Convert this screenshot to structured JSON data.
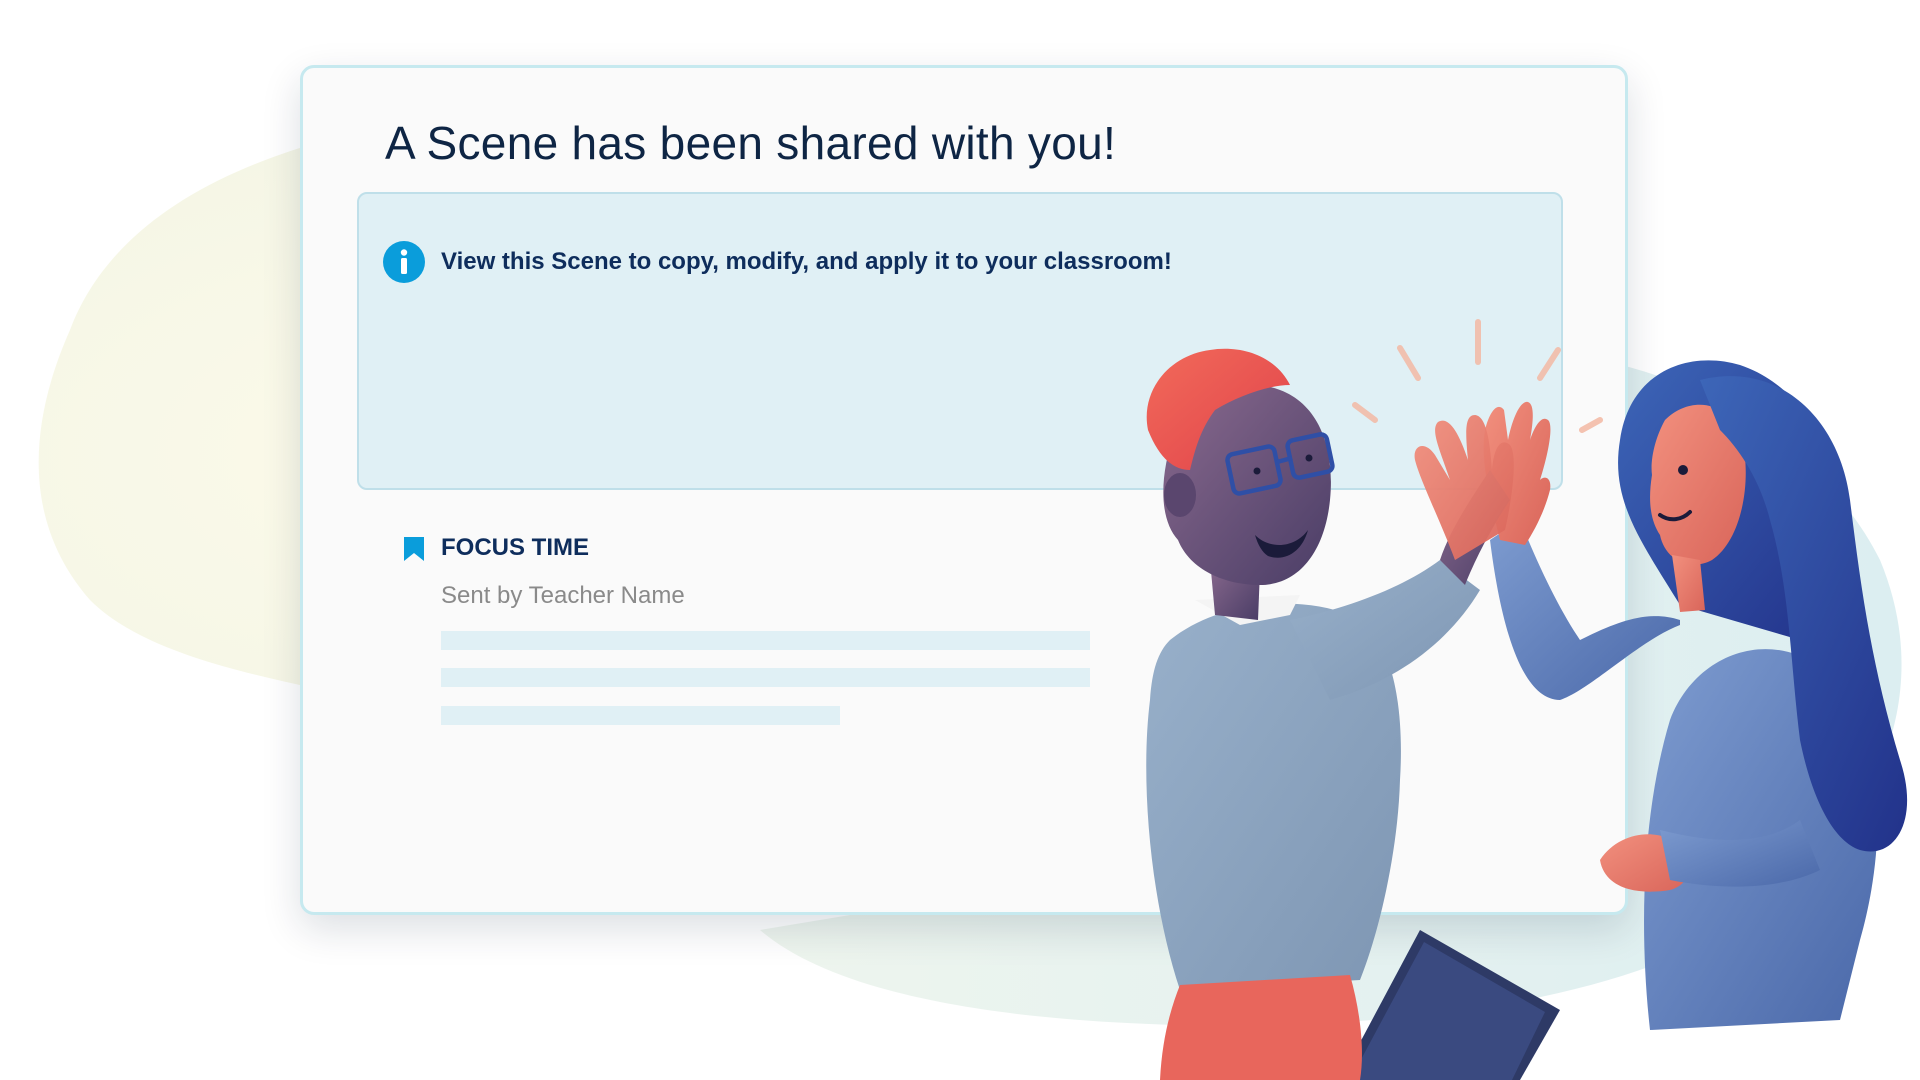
{
  "dialog": {
    "title": "A Scene has been shared with you!",
    "info": {
      "icon": "info-circle-icon",
      "text": "View this Scene to copy, modify, and apply it to your classroom!"
    },
    "scene": {
      "icon": "bookmark-icon",
      "name": "FOCUS TIME",
      "sender": "Sent by Teacher Name"
    }
  },
  "colors": {
    "title": "#0e2544",
    "info_background": "#e0f0f5",
    "info_icon": "#0a9ddb",
    "bookmark": "#0a9ddb",
    "scene_name": "#0e2d5c",
    "sender": "#8a8a8a",
    "card_border": "#c6e9ef"
  }
}
